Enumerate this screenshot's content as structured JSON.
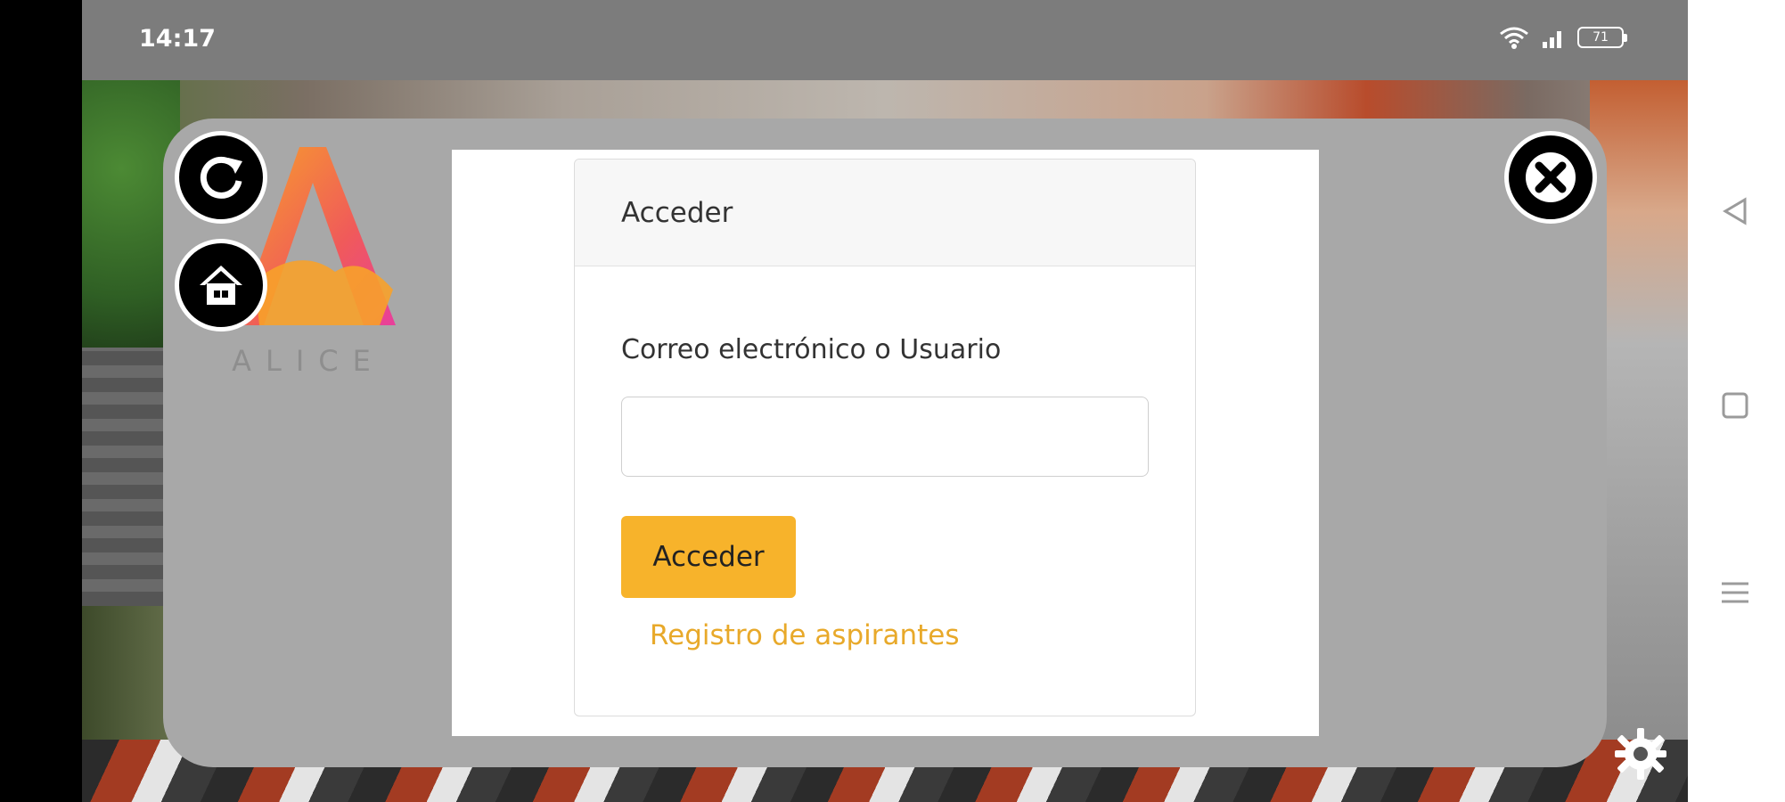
{
  "status_bar": {
    "time": "14:17",
    "battery": "71",
    "icons": [
      "wifi-icon",
      "signal-icon",
      "battery-icon"
    ]
  },
  "app": {
    "logo_text": "ALICE",
    "buttons": {
      "refresh": "refresh-icon",
      "home": "home-icon",
      "close": "close-icon",
      "settings": "gear-icon"
    }
  },
  "login": {
    "header": "Acceder",
    "field_label": "Correo electrónico o Usuario",
    "field_value": "",
    "submit_label": "Acceder",
    "register_link": "Registro de aspirantes"
  },
  "navigation": {
    "icons": [
      "back-icon",
      "square-icon",
      "menu-icon"
    ]
  },
  "colors": {
    "accent": "#f7b32b",
    "link": "#e8a92a",
    "panel": "#a8a8a8"
  }
}
